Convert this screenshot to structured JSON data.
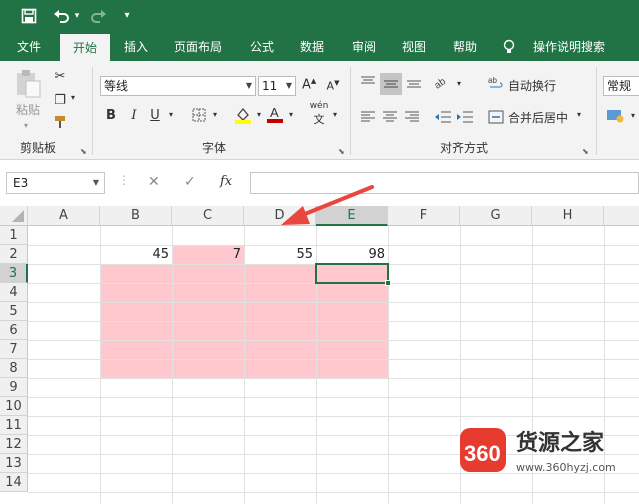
{
  "quick_access": {
    "save": "save-icon",
    "undo": "undo-icon",
    "redo": "redo-icon",
    "customize": "▾"
  },
  "tabs": [
    "文件",
    "开始",
    "插入",
    "页面布局",
    "公式",
    "数据",
    "审阅",
    "视图",
    "帮助"
  ],
  "tell_me": "操作说明搜索",
  "clipboard": {
    "paste": "粘贴",
    "label": "剪贴板"
  },
  "font": {
    "name": "等线",
    "size": "11",
    "bold": "B",
    "italic": "I",
    "underline": "U",
    "label": "字体",
    "font_color": "#c00000",
    "fill_color": "#ffff00",
    "phonetic": "wén"
  },
  "alignment": {
    "wrap": "自动换行",
    "merge": "合并后居中",
    "label": "对齐方式"
  },
  "number": {
    "format": "常规"
  },
  "formula_bar": {
    "name_box": "E3",
    "fx": "fx",
    "formula": ""
  },
  "columns": [
    "A",
    "B",
    "C",
    "D",
    "E",
    "F",
    "G",
    "H"
  ],
  "selected_column": "E",
  "rows": [
    "1",
    "2",
    "3",
    "4",
    "5",
    "6",
    "7",
    "8",
    "9",
    "10",
    "11",
    "12",
    "13",
    "14"
  ],
  "selected_row": "3",
  "cells": {
    "B2": "45",
    "C2": "7",
    "D2": "55",
    "E2": "98"
  },
  "colors": {
    "accent": "#217346",
    "highlight": "#ffc7ce",
    "annotation_arrow": "#e8463e"
  }
}
